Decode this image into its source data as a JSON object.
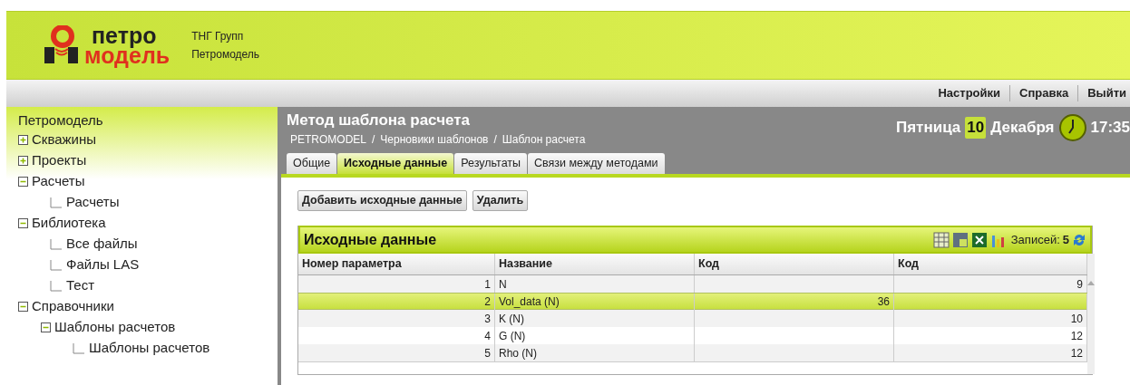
{
  "logo": {
    "line1": "петро",
    "line2": "модель"
  },
  "company": [
    "ТНГ Групп",
    "Петромодель"
  ],
  "top_links": [
    "Настройки",
    "Справка",
    "Выйти"
  ],
  "sidebar": {
    "title": "Петромодель",
    "items": [
      {
        "label": "Скважины",
        "expanded": false
      },
      {
        "label": "Проекты",
        "expanded": false
      },
      {
        "label": "Расчеты",
        "expanded": true,
        "children": [
          {
            "label": "Расчеты"
          }
        ]
      },
      {
        "label": "Библиотека",
        "expanded": true,
        "children": [
          {
            "label": "Все файлы"
          },
          {
            "label": "Файлы LAS"
          },
          {
            "label": "Тест"
          }
        ]
      },
      {
        "label": "Справочники",
        "expanded": true,
        "children": [
          {
            "label": "Шаблоны расчетов",
            "expanded": true,
            "children": [
              {
                "label": "Шаблоны расчетов"
              }
            ]
          }
        ]
      }
    ]
  },
  "page": {
    "title": "Метод шаблона расчета",
    "breadcrumbs": [
      "PETROMODEL",
      "Черновики шаблонов",
      "Шаблон расчета"
    ],
    "separator": "/"
  },
  "date": {
    "weekday": "Пятница",
    "day": "10",
    "month": "Декабря",
    "time": "17:35"
  },
  "tabs": [
    {
      "label": "Общие",
      "selected": false
    },
    {
      "label": "Исходные данные",
      "selected": true
    },
    {
      "label": "Результаты",
      "selected": false
    },
    {
      "label": "Связи между методами",
      "selected": false
    }
  ],
  "buttons": [
    "Добавить исходные данные",
    "Удалить"
  ],
  "grid": {
    "title": "Исходные данные",
    "records_label": "Записей:",
    "records": "5",
    "columns": [
      "Номер параметра",
      "Название",
      "Код",
      "Код"
    ],
    "rows": [
      {
        "cells": [
          "1",
          "N",
          "",
          "9"
        ],
        "selected": false
      },
      {
        "cells": [
          "2",
          "Vol_data (N)",
          "36",
          ""
        ],
        "selected": true
      },
      {
        "cells": [
          "3",
          "K (N)",
          "",
          "10"
        ],
        "selected": false
      },
      {
        "cells": [
          "4",
          "G (N)",
          "",
          "12"
        ],
        "selected": false
      },
      {
        "cells": [
          "5",
          "Rho (N)",
          "",
          "12"
        ],
        "selected": false
      }
    ]
  }
}
